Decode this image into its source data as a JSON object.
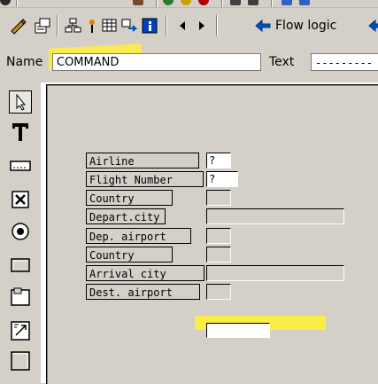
{
  "toolbar": {
    "flow_logic_label": "Flow logic"
  },
  "name_row": {
    "name_label": "Name",
    "name_value": "COMMAND",
    "text_label": "Text",
    "text_value": "---------"
  },
  "palette": {
    "items": [
      "pointer-tool",
      "text-tool",
      "input-field-tool",
      "checkbox-tool",
      "radio-button-tool",
      "pushbutton-tool",
      "frame-tool",
      "subscreen-tool",
      "table-control-tool"
    ]
  },
  "screen": {
    "labels": [
      "Airline",
      "Flight Number",
      "Country",
      "Depart.city",
      "Dep. airport",
      "Country",
      "Arrival city",
      "Dest. airport"
    ],
    "field_values": [
      "?",
      "?"
    ]
  },
  "colors": {
    "highlight": "#ffef3a",
    "background": "#d4d0c8"
  }
}
